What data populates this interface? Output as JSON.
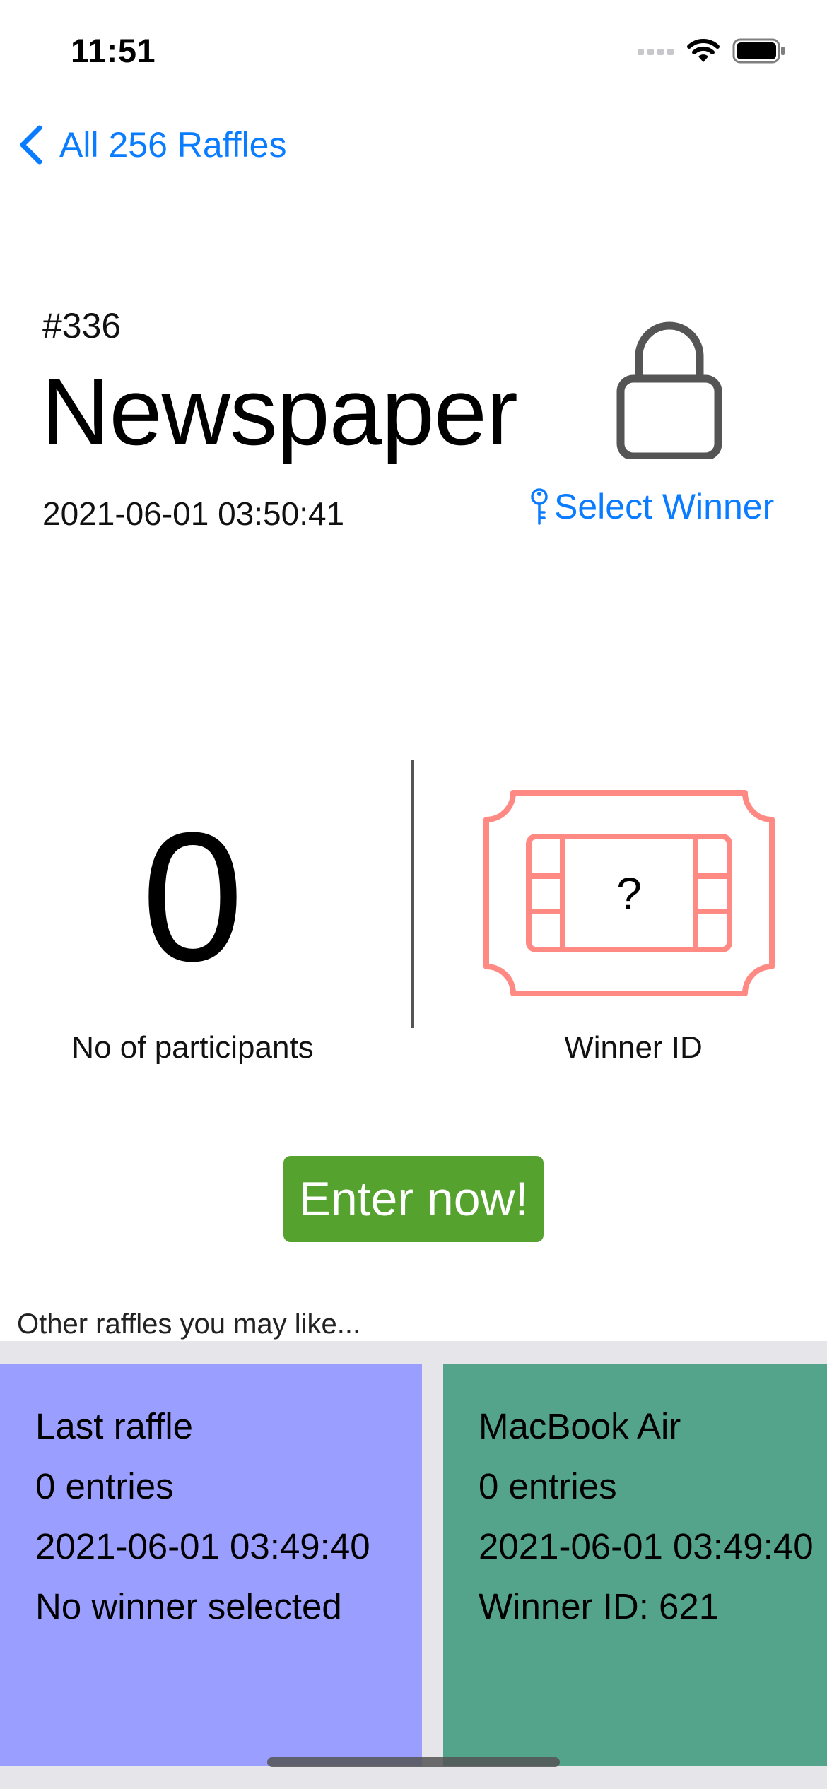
{
  "status_bar": {
    "time": "11:51",
    "icons": [
      "cellular-icon",
      "wifi-icon",
      "battery-icon"
    ]
  },
  "nav": {
    "back_label": "All 256 Raffles",
    "back_icon": "chevron-left-icon"
  },
  "raffle": {
    "number": "#336",
    "title": "Newspaper",
    "date": "2021-06-01 03:50:41",
    "status_icon": "lock-icon",
    "select_winner_label": "Select Winner",
    "select_winner_icon": "key-icon"
  },
  "stats": {
    "participants_count": "0",
    "participants_label": "No of participants",
    "winner_placeholder": "?",
    "winner_icon": "ticket-icon",
    "winner_label": "Winner ID"
  },
  "enter_button_label": "Enter now!",
  "other_raffles": {
    "heading": "Other raffles you may like...",
    "cards": [
      {
        "title": "Last raffle",
        "entries": "0 entries",
        "date": "2021-06-01 03:49:40",
        "winner": "No winner selected",
        "color": "#9a9efe"
      },
      {
        "title": "MacBook Air",
        "entries": "0 entries",
        "date": "2021-06-01 03:49:40",
        "winner": "Winner ID: 621",
        "color": "#54a48b"
      }
    ]
  },
  "colors": {
    "accent": "#0a7cff",
    "enter_button": "#56a22f",
    "ticket": "#ff8a84"
  }
}
